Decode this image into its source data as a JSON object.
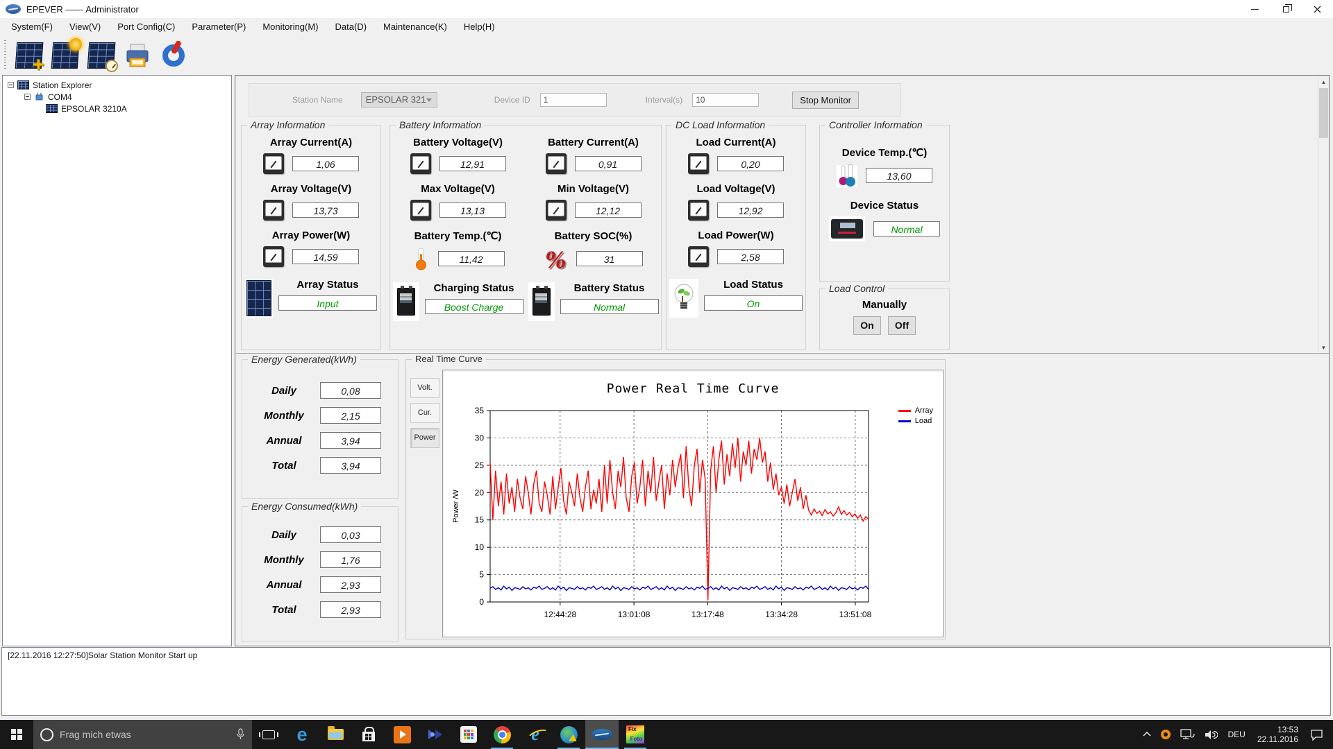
{
  "window": {
    "title": "EPEVER —— Administrator"
  },
  "menu": {
    "items": [
      "System(F)",
      "View(V)",
      "Port Config(C)",
      "Parameter(P)",
      "Monitoring(M)",
      "Data(D)",
      "Maintenance(K)",
      "Help(H)"
    ]
  },
  "tree": {
    "root": "Station Explorer",
    "com_port": "COM4",
    "device": "EPSOLAR 3210A"
  },
  "station_bar": {
    "station_name_label": "Station Name",
    "station_name": "EPSOLAR 321",
    "device_id_label": "Device ID",
    "device_id": "1",
    "interval_label": "Interval(s)",
    "interval": "10",
    "stop_monitor": "Stop Monitor"
  },
  "array_info": {
    "title": "Array Information",
    "current_label": "Array Current(A)",
    "current": "1,06",
    "voltage_label": "Array Voltage(V)",
    "voltage": "13,73",
    "power_label": "Array Power(W)",
    "power": "14,59",
    "status_label": "Array Status",
    "status": "Input"
  },
  "battery_info": {
    "title": "Battery Information",
    "voltage_label": "Battery Voltage(V)",
    "voltage": "12,91",
    "current_label": "Battery Current(A)",
    "current": "0,91",
    "max_voltage_label": "Max Voltage(V)",
    "max_voltage": "13,13",
    "min_voltage_label": "Min Voltage(V)",
    "min_voltage": "12,12",
    "temp_label": "Battery Temp.(℃)",
    "temp": "11,42",
    "soc_label": "Battery SOC(%)",
    "soc": "31",
    "charging_status_label": "Charging Status",
    "charging_status": "Boost Charge",
    "battery_status_label": "Battery Status",
    "battery_status": "Normal"
  },
  "dc_load_info": {
    "title": "DC Load Information",
    "current_label": "Load Current(A)",
    "current": "0,20",
    "voltage_label": "Load Voltage(V)",
    "voltage": "12,92",
    "power_label": "Load Power(W)",
    "power": "2,58",
    "status_label": "Load Status",
    "status": "On"
  },
  "controller_info": {
    "title": "Controller Information",
    "temp_label": "Device Temp.(℃)",
    "temp": "13,60",
    "status_label": "Device Status",
    "status": "Normal"
  },
  "load_control": {
    "title": "Load Control",
    "manually_label": "Manually",
    "on_button": "On",
    "off_button": "Off"
  },
  "energy_generated": {
    "title": "Energy Generated(kWh)",
    "rows": [
      {
        "label": "Daily",
        "value": "0,08"
      },
      {
        "label": "Monthly",
        "value": "2,15"
      },
      {
        "label": "Annual",
        "value": "3,94"
      },
      {
        "label": "Total",
        "value": "3,94"
      }
    ]
  },
  "energy_consumed": {
    "title": "Energy Consumed(kWh)",
    "rows": [
      {
        "label": "Daily",
        "value": "0,03"
      },
      {
        "label": "Monthly",
        "value": "1,76"
      },
      {
        "label": "Annual",
        "value": "2,93"
      },
      {
        "label": "Total",
        "value": "2,93"
      }
    ]
  },
  "curve_panel": {
    "title": "Real Time Curve",
    "tabs": [
      "Volt.",
      "Cur.",
      "Power"
    ],
    "active_tab": "Power"
  },
  "chart_data": {
    "type": "line",
    "title": "Power Real Time Curve",
    "ylabel": "Power /W",
    "ylim": [
      0,
      35
    ],
    "y_ticks": [
      0,
      5,
      10,
      15,
      20,
      25,
      30,
      35
    ],
    "x_tick_labels": [
      "12:44:28",
      "13:01:08",
      "13:17:48",
      "13:34:28",
      "13:51:08"
    ],
    "x_tick_fractions": [
      0.185,
      0.38,
      0.575,
      0.77,
      0.965
    ],
    "grid": true,
    "legend_position": "top-right",
    "series": [
      {
        "name": "Array",
        "color": "#ff0000",
        "values": [
          25.5,
          15,
          24,
          17.5,
          22,
          16,
          23.5,
          18,
          21,
          16.5,
          22.5,
          19,
          17,
          23,
          20,
          16,
          21.5,
          24,
          18,
          16.5,
          22,
          19.5,
          16,
          23,
          17,
          21,
          24.5,
          18.5,
          16,
          22,
          20,
          17.5,
          23.5,
          19,
          16.5,
          21,
          24,
          17,
          20.5,
          18,
          22.5,
          16.5,
          25,
          18,
          26,
          20,
          17,
          24,
          21,
          26.5,
          19,
          16.5,
          23,
          25.5,
          18,
          21,
          26,
          17.5,
          24,
          20,
          26.5,
          18.5,
          22,
          25,
          17,
          23.5,
          19.5,
          26,
          21,
          24.5,
          27,
          19,
          28.5,
          21,
          17.5,
          25,
          28,
          20,
          26,
          22.5,
          0.3,
          24,
          28.5,
          20,
          26,
          29.5,
          21.5,
          27,
          23,
          29,
          24.5,
          30,
          22,
          27.5,
          25,
          29.5,
          23.5,
          28,
          26,
          30,
          25.5,
          27.5,
          22,
          25.5,
          20.5,
          23.5,
          19.5,
          21,
          18,
          21.5,
          17.5,
          20,
          22.5,
          18.5,
          21,
          17,
          19.5,
          16.8,
          15.9,
          17,
          16.2,
          16.6,
          15.8,
          16.9,
          16.1,
          16.5,
          15.7,
          16.3,
          17.4,
          16,
          16.7,
          15.9,
          16.4,
          15.6,
          16.1,
          15.3,
          15.9,
          14.8,
          15.6,
          15.1
        ]
      },
      {
        "name": "Load",
        "color": "#0000cd",
        "values": [
          2.5,
          2.8,
          2.3,
          2.6,
          2.2,
          2.9,
          2.4,
          2.7,
          2.1,
          2.6,
          2.5,
          2.3,
          2.8,
          2.4,
          2.6,
          2.2,
          2.7,
          2.5,
          2.9,
          2.3,
          2.5,
          2.8,
          2.3,
          2.6,
          2.2,
          2.9,
          2.4,
          2.7,
          2.1,
          2.6,
          2.5,
          2.3,
          2.8,
          2.4,
          2.6,
          2.2,
          2.7,
          2.5,
          2.9,
          2.3,
          2.5,
          2.8,
          2.3,
          2.6,
          2.2,
          2.9,
          2.4,
          2.7,
          2.1,
          2.6,
          2.5,
          2.3,
          2.8,
          2.4,
          2.6,
          2.2,
          2.7,
          2.5,
          2.9,
          2.3,
          2.5,
          2.8,
          2.3,
          2.6,
          2.2,
          2.9,
          2.4,
          2.7,
          2.1,
          2.6,
          2.5,
          2.3,
          2.8,
          2.4,
          2.6,
          2.2,
          2.7,
          2.5,
          2.9,
          2.3,
          2.5,
          2.8,
          2.3,
          2.6,
          2.2,
          2.9,
          2.4,
          2.7,
          2.1,
          2.6,
          2.5,
          2.3,
          2.8,
          2.4,
          2.6,
          2.2,
          2.7,
          2.5,
          2.9,
          2.3,
          2.5,
          2.8,
          2.3,
          2.6,
          2.2,
          2.9,
          2.4,
          2.7,
          2.1,
          2.6,
          2.5,
          2.3,
          2.8,
          2.4,
          2.6,
          2.2,
          2.7,
          2.5,
          2.9,
          2.3,
          2.5,
          2.8,
          2.3,
          2.6,
          2.2,
          2.9,
          2.4,
          2.7,
          2.1,
          2.6,
          2.5,
          2.3,
          2.8,
          2.4,
          2.6,
          2.2,
          2.7,
          2.5,
          2.9,
          2.3
        ]
      }
    ]
  },
  "status_log": "[22.11.2016 12:27:50]Solar Station Monitor Start up",
  "taskbar": {
    "search_placeholder": "Frag mich etwas",
    "language": "DEU",
    "time": "13:53",
    "date": "22.11.2016",
    "fixfoto_line1": "Fix",
    "fixfoto_line2": "Foto"
  },
  "colors": {
    "status_green": "#009a00",
    "series_array": "#ff0000",
    "series_load": "#0000cd",
    "taskbar_underline": "#76b9ed"
  }
}
